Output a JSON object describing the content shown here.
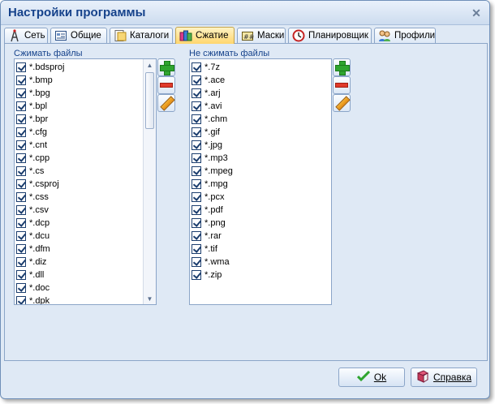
{
  "window": {
    "title": "Настройки программы"
  },
  "tabs": [
    {
      "label": "Сеть",
      "icon": "network-icon"
    },
    {
      "label": "Общие",
      "icon": "general-icon"
    },
    {
      "label": "Каталоги",
      "icon": "folders-icon"
    },
    {
      "label": "Сжатие",
      "icon": "compression-icon",
      "active": true
    },
    {
      "label": "Маски",
      "icon": "masks-icon"
    },
    {
      "label": "Планировщик",
      "icon": "scheduler-icon"
    },
    {
      "label": "Профили",
      "icon": "profiles-icon"
    }
  ],
  "compress": {
    "label": "Сжимать файлы",
    "items": [
      "*.bdsproj",
      "*.bmp",
      "*.bpg",
      "*.bpl",
      "*.bpr",
      "*.cfg",
      "*.cnt",
      "*.cpp",
      "*.cs",
      "*.csproj",
      "*.css",
      "*.csv",
      "*.dcp",
      "*.dcu",
      "*.dfm",
      "*.diz",
      "*.dll",
      "*.doc",
      "*.dpk"
    ]
  },
  "nocompress": {
    "label": "Не сжимать файлы",
    "items": [
      "*.7z",
      "*.ace",
      "*.arj",
      "*.avi",
      "*.chm",
      "*.gif",
      "*.jpg",
      "*.mp3",
      "*.mpeg",
      "*.mpg",
      "*.pcx",
      "*.pdf",
      "*.png",
      "*.rar",
      "*.tif",
      "*.wma",
      "*.zip"
    ]
  },
  "footer": {
    "ok_label": "Ok",
    "help_label": "Справка"
  },
  "colors": {
    "accent": "#15428b",
    "active_tab": "#ffd66e",
    "frame": "#dfe9f5"
  }
}
